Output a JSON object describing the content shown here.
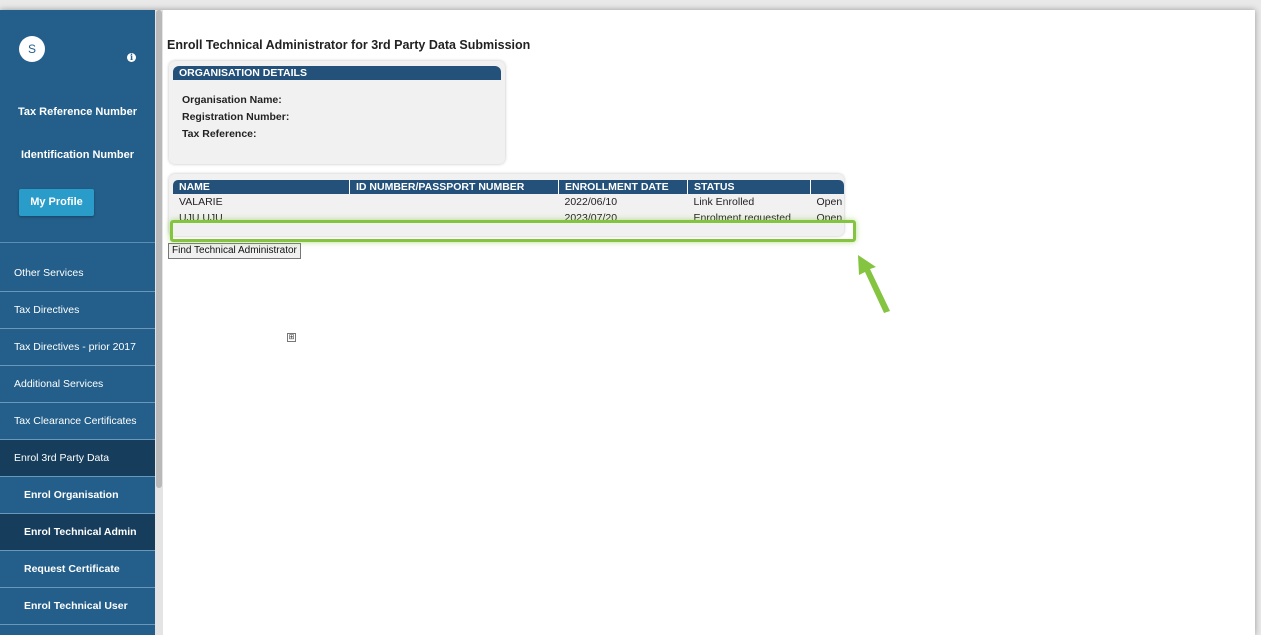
{
  "sidebar": {
    "avatar_initial": "S",
    "tax_reference_label": "Tax Reference Number",
    "identification_label": "Identification Number",
    "profile_button": "My Profile",
    "nav": [
      {
        "label": "Other Services"
      },
      {
        "label": "Tax Directives"
      },
      {
        "label": "Tax Directives - prior 2017"
      },
      {
        "label": "Additional Services"
      },
      {
        "label": "Tax Clearance Certificates"
      },
      {
        "label": "Enrol 3rd Party Data"
      },
      {
        "label": "Enrol Organisation"
      },
      {
        "label": "Enrol Technical Admin"
      },
      {
        "label": "Request Certificate"
      },
      {
        "label": "Enrol Technical User"
      }
    ]
  },
  "main": {
    "title": "Enroll Technical Administrator for 3rd Party Data Submission",
    "org": {
      "header": "ORGANISATION DETAILS",
      "name_label": "Organisation Name:",
      "reg_label": "Registration Number:",
      "tax_label": "Tax Reference:"
    },
    "table": {
      "headers": [
        "NAME",
        "ID NUMBER/PASSPORT NUMBER",
        "ENROLLMENT DATE",
        "STATUS",
        ""
      ],
      "rows": [
        {
          "name": "VALARIE",
          "id": "",
          "date": "2022/06/10",
          "status": "Link Enrolled",
          "action": "Open"
        },
        {
          "name": "UJU UJU",
          "id": "",
          "date": "2023/07/20",
          "status": "Enrolment requested",
          "action": "Open"
        }
      ]
    },
    "find_button": "Find Technical Administrator",
    "expand_glyph": "⊞"
  },
  "colors": {
    "sidebar": "#235f8a",
    "header": "#23517a",
    "highlight": "#84c441",
    "profile_button": "#2a9cc9"
  }
}
